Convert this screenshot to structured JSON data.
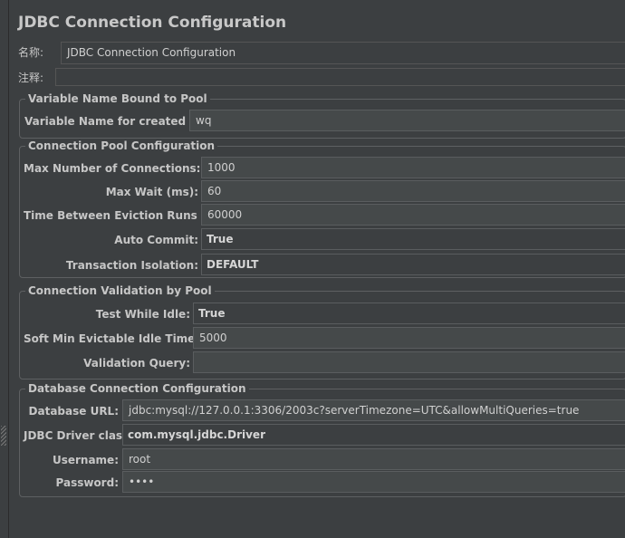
{
  "title": "JDBC Connection Configuration",
  "name_label": "名称:",
  "name_value": "JDBC Connection Configuration",
  "comment_label": "注释:",
  "comment_value": "",
  "variable_section": {
    "legend": "Variable Name Bound to Pool",
    "pool_label": "Variable Name for created pool:",
    "pool_value": "wq"
  },
  "pool_section": {
    "legend": "Connection Pool Configuration",
    "max_conn_label": "Max Number of Connections:",
    "max_conn_value": "1000",
    "max_wait_label": "Max Wait (ms):",
    "max_wait_value": "60",
    "eviction_label": "Time Between Eviction Runs (ms):",
    "eviction_value": "60000",
    "auto_commit_label": "Auto Commit:",
    "auto_commit_value": "True",
    "isolation_label": "Transaction Isolation:",
    "isolation_value": "DEFAULT"
  },
  "validation_section": {
    "legend": "Connection Validation by Pool",
    "test_idle_label": "Test While Idle:",
    "test_idle_value": "True",
    "soft_min_label": "Soft Min Evictable Idle Time(ms):",
    "soft_min_value": "5000",
    "query_label": "Validation Query:",
    "query_value": ""
  },
  "db_section": {
    "legend": "Database Connection Configuration",
    "url_label": "Database URL:",
    "url_value": "jdbc:mysql://127.0.0.1:3306/2003c?serverTimezone=UTC&allowMultiQueries=true",
    "driver_label": "JDBC Driver class:",
    "driver_value": "com.mysql.jdbc.Driver",
    "username_label": "Username:",
    "username_value": "root",
    "password_label": "Password:",
    "password_value": "••••"
  }
}
